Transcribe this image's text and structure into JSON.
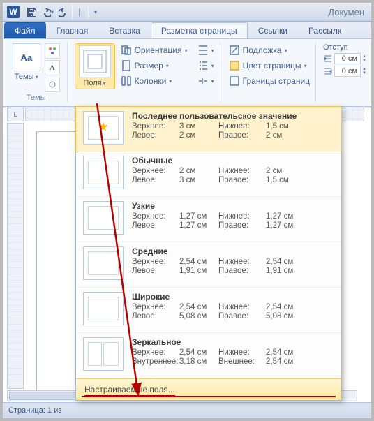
{
  "titlebar": {
    "app_letter": "W",
    "doc_title": "Докумен"
  },
  "qat": {
    "save": "save-icon",
    "undo": "undo-icon",
    "redo": "redo-icon",
    "sep": "|"
  },
  "tabs": {
    "file": "Файл",
    "home": "Главная",
    "insert": "Вставка",
    "layout": "Разметка страницы",
    "references": "Ссылки",
    "mailings": "Рассылк"
  },
  "ribbon": {
    "themes": {
      "big_label": "Aa",
      "label": "Темы",
      "group": "Темы"
    },
    "margins": {
      "label": "Поля"
    },
    "page_setup": {
      "orientation": "Ориентация",
      "size": "Размер",
      "columns": "Колонки"
    },
    "page_bg": {
      "watermark": "Подложка",
      "page_color": "Цвет страницы",
      "page_borders": "Границы страниц"
    },
    "indent": {
      "caption": "Отступ",
      "left_value": "0 см",
      "right_value": "0 см"
    }
  },
  "gallery": {
    "presets": [
      {
        "key": "last",
        "star": true,
        "title": "Последнее пользовательское значение",
        "top_l": "Верхнее:",
        "top_v": "3 см",
        "bot_l": "Нижнее:",
        "bot_v": "1,5 см",
        "left_l": "Левое:",
        "left_v": "2 см",
        "right_l": "Правое:",
        "right_v": "2 см"
      },
      {
        "key": "normal",
        "title": "Обычные",
        "top_l": "Верхнее:",
        "top_v": "2 см",
        "bot_l": "Нижнее:",
        "bot_v": "2 см",
        "left_l": "Левое:",
        "left_v": "3 см",
        "right_l": "Правое:",
        "right_v": "1,5 см"
      },
      {
        "key": "narrow",
        "title": "Узкие",
        "top_l": "Верхнее:",
        "top_v": "1,27 см",
        "bot_l": "Нижнее:",
        "bot_v": "1,27 см",
        "left_l": "Левое:",
        "left_v": "1,27 см",
        "right_l": "Правое:",
        "right_v": "1,27 см"
      },
      {
        "key": "moderate",
        "title": "Средние",
        "top_l": "Верхнее:",
        "top_v": "2,54 см",
        "bot_l": "Нижнее:",
        "bot_v": "2,54 см",
        "left_l": "Левое:",
        "left_v": "1,91 см",
        "right_l": "Правое:",
        "right_v": "1,91 см"
      },
      {
        "key": "wide",
        "title": "Широкие",
        "top_l": "Верхнее:",
        "top_v": "2,54 см",
        "bot_l": "Нижнее:",
        "bot_v": "2,54 см",
        "left_l": "Левое:",
        "left_v": "5,08 см",
        "right_l": "Правое:",
        "right_v": "5,08 см"
      },
      {
        "key": "mirrored",
        "mirror": true,
        "title": "Зеркальное",
        "top_l": "Верхнее:",
        "top_v": "2,54 см",
        "bot_l": "Нижнее:",
        "bot_v": "2,54 см",
        "left_l": "Внутреннее:",
        "left_v": "3,18 см",
        "right_l": "Внешнее:",
        "right_v": "2,54 см"
      }
    ],
    "custom": "Настраиваемые поля..."
  },
  "status": {
    "page": "Страница: 1 из"
  },
  "ruler_corner": "L"
}
